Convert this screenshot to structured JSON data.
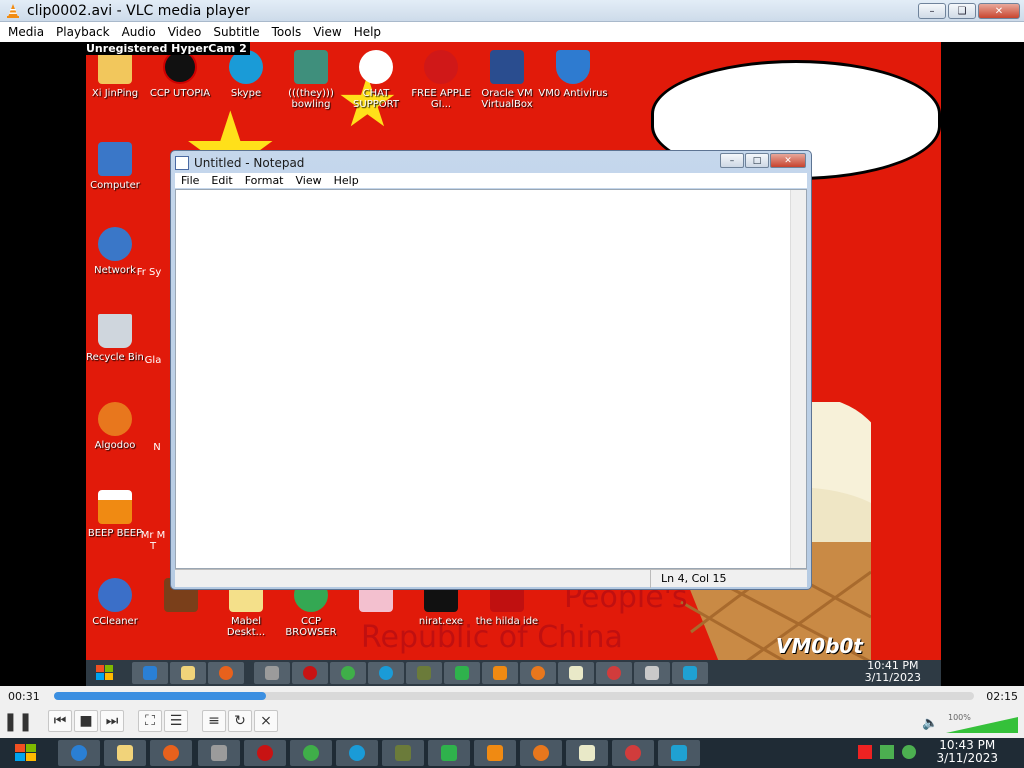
{
  "window": {
    "title": "clip0002.avi - VLC media player"
  },
  "menu": [
    "Media",
    "Playback",
    "Audio",
    "Video",
    "Subtitle",
    "Tools",
    "View",
    "Help"
  ],
  "recording": {
    "watermark_top": "Unregistered HyperCam 2",
    "watermark_bottom": "VM0b0t",
    "speech_bubble": "",
    "poster_text": [
      "People's",
      "Republic of China"
    ],
    "desktop_icons": [
      {
        "label": "Xi JinPing",
        "color": "#f2c75c"
      },
      {
        "label": "CCP UTOPIA",
        "color": "#111111"
      },
      {
        "label": "Skype",
        "color": "#1a9bd7"
      },
      {
        "label": "(((they))) bowling",
        "color": "#3f8f7c"
      },
      {
        "label": "CHAT SUPPORT",
        "color": "#ffffff"
      },
      {
        "label": "FREE APPLE GI...",
        "color": "#d01818"
      },
      {
        "label": "Oracle VM VirtualBox",
        "color": "#2a4d8f"
      },
      {
        "label": "VM0 Antivirus",
        "color": "#2e7bd0"
      },
      {
        "label": "Computer",
        "color": "#3a77c8"
      },
      {
        "label": "Network",
        "color": "#3a77c8"
      },
      {
        "label": "Recycle Bin",
        "color": "#cfd6dd"
      },
      {
        "label": "Algodoo",
        "color": "#e8771d"
      },
      {
        "label": "BEEP BEEP",
        "color": "#f08a12"
      },
      {
        "label": "CCleaner",
        "color": "#3b6fc8"
      },
      {
        "label": "",
        "color": "#7a3f1a"
      },
      {
        "label": "Mabel Deskt...",
        "color": "#f4e08a"
      },
      {
        "label": "CCP BROWSER",
        "color": "#34a853"
      },
      {
        "label": "",
        "color": "#f3c0cf"
      },
      {
        "label": "nirat.exe",
        "color": "#111111"
      },
      {
        "label": "the hilda ide",
        "color": "#c01010"
      }
    ],
    "partial_labels": [
      "Fr Sy",
      "Gla",
      "N",
      "Mr M T"
    ],
    "taskbar_clock": {
      "time": "10:41 PM",
      "date": "3/11/2023"
    }
  },
  "notepad": {
    "title": "Untitled - Notepad",
    "menu": [
      "File",
      "Edit",
      "Format",
      "View",
      "Help"
    ],
    "text": "",
    "status": "Ln 4, Col 15"
  },
  "player": {
    "elapsed": "00:31",
    "total": "02:15",
    "progress_fraction": 0.23,
    "volume_label": "100%",
    "volume_fraction": 1.0
  },
  "host": {
    "clock": {
      "time": "10:43 PM",
      "date": "3/11/2023"
    }
  },
  "colors": {
    "accent": "#3b8fe1",
    "desktop_bg": "#e11a0a",
    "bubble_text": "#d81414"
  }
}
